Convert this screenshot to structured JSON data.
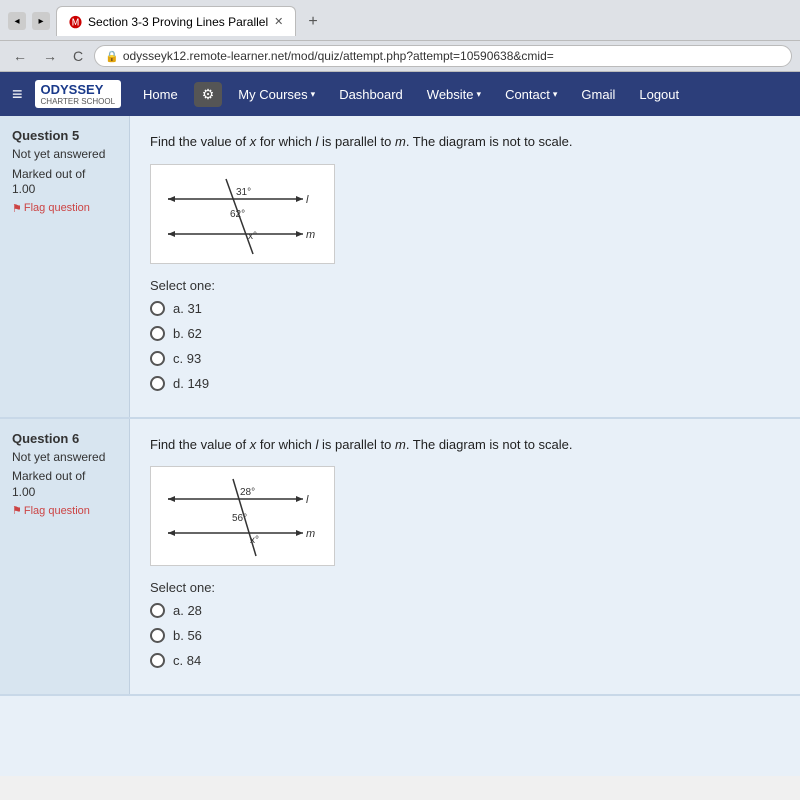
{
  "browser": {
    "tab_title": "Section 3-3 Proving Lines Parallel",
    "url": "odysseyk12.remote-learner.net/mod/quiz/attempt.php?attempt=10590638&cmid=",
    "nav_back": "←",
    "nav_forward": "→",
    "nav_refresh": "C"
  },
  "navbar": {
    "home": "Home",
    "my_courses": "My Courses",
    "dashboard": "Dashboard",
    "website": "Website",
    "contact": "Contact",
    "gmail": "Gmail",
    "logout": "Logout",
    "logo": "ODYSSEY",
    "logo_sub": "CHARTER SCHOOL"
  },
  "question5": {
    "number": "5",
    "status_label": "Not yet answered",
    "marked_label": "Marked out of",
    "marked_value": "1.00",
    "flag_label": "Flag question",
    "question_text": "Find the value of x for which l is parallel to m. The diagram is not to scale.",
    "angle1": "31°",
    "angle2": "62°",
    "line_l": "l",
    "line_m": "m",
    "select_one": "Select one:",
    "options": [
      {
        "key": "a",
        "value": "31"
      },
      {
        "key": "b",
        "value": "62"
      },
      {
        "key": "c",
        "value": "93"
      },
      {
        "key": "d",
        "value": "149"
      }
    ]
  },
  "question6": {
    "number": "6",
    "status_label": "Not yet answered",
    "marked_label": "Marked out of",
    "marked_value": "1.00",
    "flag_label": "Flag question",
    "question_text": "Find the value of x for which l is parallel to m. The diagram is not to scale.",
    "angle1": "28°",
    "angle2": "56°",
    "line_l": "l",
    "line_m": "m",
    "select_one": "Select one:",
    "options": [
      {
        "key": "a",
        "value": "28"
      },
      {
        "key": "b",
        "value": "56"
      },
      {
        "key": "c",
        "value": "84"
      }
    ]
  }
}
